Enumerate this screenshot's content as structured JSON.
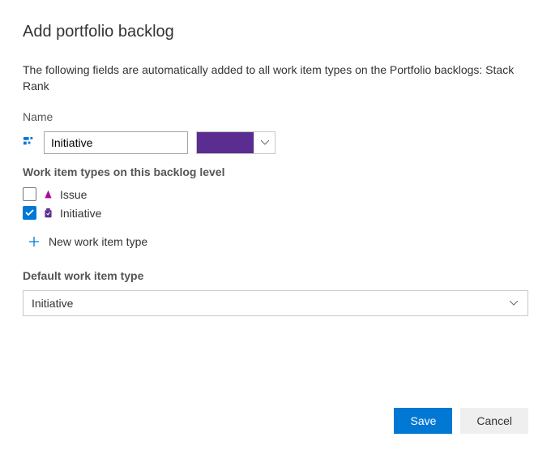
{
  "dialog": {
    "title": "Add portfolio backlog",
    "description": "The following fields are automatically added to all work item types on the Portfolio backlogs: Stack Rank"
  },
  "name_field": {
    "label": "Name",
    "value": "Initiative",
    "color": "#5c2d91"
  },
  "work_item_types": {
    "heading": "Work item types on this backlog level",
    "items": [
      {
        "label": "Issue",
        "checked": false,
        "icon": "issue-icon",
        "icon_color": "#b4009e"
      },
      {
        "label": "Initiative",
        "checked": true,
        "icon": "initiative-icon",
        "icon_color": "#5c2d91"
      }
    ],
    "add_new_label": "New work item type"
  },
  "default_wit": {
    "label": "Default work item type",
    "value": "Initiative"
  },
  "footer": {
    "save_label": "Save",
    "cancel_label": "Cancel"
  }
}
